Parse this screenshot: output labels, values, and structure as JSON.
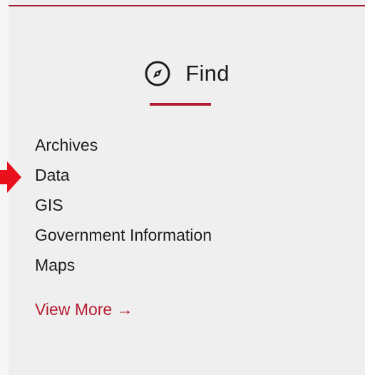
{
  "section": {
    "title": "Find",
    "icon": "compass-icon",
    "links": [
      {
        "label": "Archives"
      },
      {
        "label": "Data"
      },
      {
        "label": "GIS"
      },
      {
        "label": "Government Information"
      },
      {
        "label": "Maps"
      }
    ],
    "view_more": "View More →"
  },
  "colors": {
    "accent": "#b41d30",
    "pointer": "#e8101a",
    "card_bg": "#efefef",
    "text": "#1e1e1e"
  }
}
